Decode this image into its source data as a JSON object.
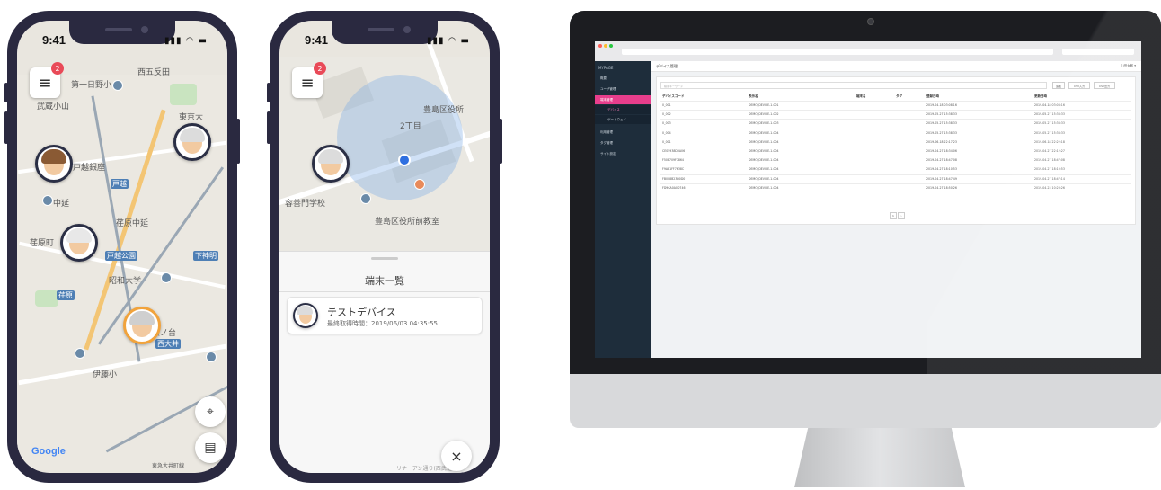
{
  "phone1": {
    "time": "9:41",
    "status_icons": "▮▮▮ ◠ ▬",
    "badge": "2",
    "map_labels": [
      "西五反田",
      "第一日野小",
      "武蔵小山",
      "東京大",
      "戸越銀座",
      "戸越",
      "中延",
      "荏原中延",
      "荏原町",
      "戸越公園",
      "下神明",
      "昭和大学",
      "伊藤小",
      "荏原",
      "西大井",
      "旗ノ台",
      "東急大井町線"
    ],
    "google": "Google"
  },
  "phone2": {
    "time": "9:41",
    "status_icons": "▮▮▮ ◠ ▬",
    "badge": "2",
    "map_labels": [
      "豊島区役所",
      "2丁目",
      "容善門学校",
      "豊島区役所前教室"
    ],
    "sheet_title": "端末一覧",
    "device_name": "テストデバイス",
    "device_time": "最終取得時間：2019/06/03 04:35:55",
    "close": "×",
    "footer_text": "リナーアン通り(西武池袋)"
  },
  "web": {
    "brand": "MYPAGE",
    "nav": [
      "概要",
      "ユーザ管理",
      "端末管理",
      "デバイス",
      "ゲートウェイ",
      "利用管理",
      "タグ管理",
      "サイト設定"
    ],
    "page_title": "デバイス管理",
    "user": "山田太郎 ▾",
    "search_placeholder": "検索キーワード",
    "buttons": [
      "追加",
      "CSV入力",
      "CSV出力"
    ],
    "columns": [
      "デバイスコード",
      "表示名",
      "端末名",
      "タグ",
      "登録日時",
      "更新日時"
    ],
    "rows": [
      [
        "0_001",
        "DEMO_DEVICE-1-001",
        "",
        "",
        "2019-04-18 03:08:16",
        "2019-04-18 03:08:16"
      ],
      [
        "0_002",
        "DEMO_DEVICE-1-002",
        "",
        "",
        "2019-05-27 15:38:33",
        "2019-05-27 15:38:33"
      ],
      [
        "0_003",
        "DEMO_DEVICE-1-003",
        "",
        "",
        "2019-05-27 15:38:33",
        "2019-05-27 15:38:33"
      ],
      [
        "0_004",
        "DEMO_DEVICE-1-004",
        "",
        "",
        "2019-05-27 15:38:33",
        "2019-05-27 15:38:33"
      ],
      [
        "0_001",
        "DEMO_DEVICE-1-004",
        "",
        "",
        "2019-06-18 22:17:23",
        "2019-06-18 22:22:18"
      ],
      [
        "CE05938D0A06",
        "DEMO_DEVICE-1-004",
        "",
        "",
        "2019-04-27 18:34:06",
        "2019-04-27 22:12:27"
      ],
      [
        "F508709F7864",
        "DEMO_DEVICE-1-004",
        "",
        "",
        "2019-04-27 18:47:08",
        "2019-04-27 18:47:08"
      ],
      [
        "F9A81FF7638C",
        "DEMO_DEVICE-1-004",
        "",
        "",
        "2019-04-27 18:10:53",
        "2019-04-27 18:10:53"
      ],
      [
        "FB008B23D0D0",
        "DEMO_DEVICE-1-004",
        "",
        "",
        "2019-04-27 18:47:49",
        "2019-04-27 18:47:14"
      ],
      [
        "FD9CA0A0D746",
        "DEMO_DEVICE-1-004",
        "",
        "",
        "2019-04-27 18:50:26",
        "2019-04-23 10:23:26"
      ]
    ],
    "pager": [
      "1",
      "›"
    ]
  },
  "icons": {
    "menu": "≡",
    "locate": "⌖",
    "list": "▤",
    "dots_colors": [
      "#ff5f57",
      "#febc2e",
      "#28c840"
    ]
  }
}
